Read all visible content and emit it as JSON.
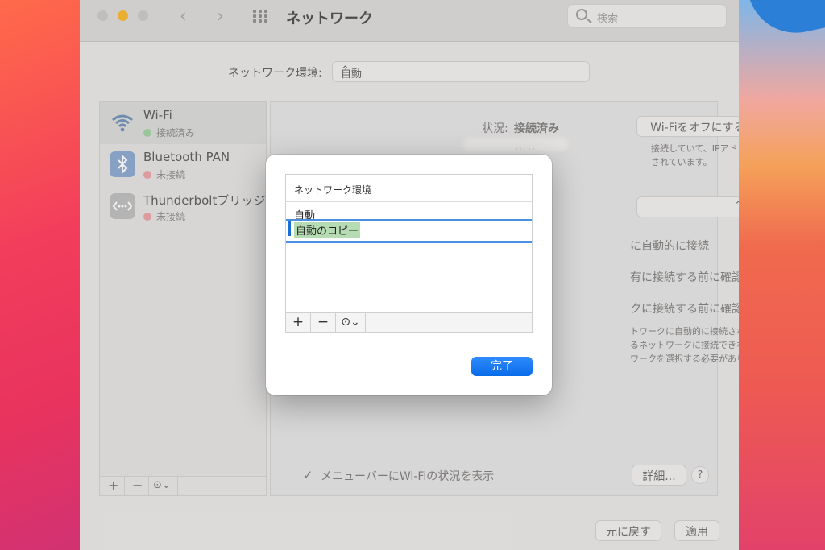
{
  "window": {
    "title": "ネットワーク",
    "search_placeholder": "検索",
    "nav_back": "‹",
    "nav_forward": "›"
  },
  "location": {
    "label": "ネットワーク環境:",
    "value": "自動"
  },
  "sidebar": {
    "services": [
      {
        "name": "Wi-Fi",
        "status": "接続済み",
        "status_color": "#5fbe60"
      },
      {
        "name": "Bluetooth PAN",
        "status": "未接続",
        "status_color": "#e5484d"
      },
      {
        "name": "Thunderboltブリッジ",
        "status": "未接続",
        "status_color": "#e5484d"
      }
    ],
    "add": "+",
    "remove": "−",
    "more": "⊙⌄"
  },
  "detail": {
    "status_label": "状況:",
    "status_value": "接続済み",
    "wifi_off_button": "Wi-Fiをオフにする",
    "desc_line1": "Wi-Fi",
    "desc_line1b": "接続していて、IPアド",
    "desc_line2": "されています。",
    "opt1": "に自動的に接続",
    "opt2": "有に接続する前に確認",
    "opt3": "クに接続する前に確認",
    "note1": "トワークに自動的に接続され",
    "note2": "るネットワークに接続できな",
    "note3": "ワークを選択する必要があり",
    "menubar_check": "メニューバーにWi-Fiの状況を表示",
    "advanced_button": "詳細...",
    "help_button": "?",
    "revert_button": "元に戻す",
    "apply_button": "適用"
  },
  "sheet": {
    "column_header": "ネットワーク環境",
    "rows": [
      "自動",
      "自動のコピー"
    ],
    "add": "+",
    "remove": "−",
    "more": "⊙⌄",
    "done_button": "完了"
  },
  "colors": {
    "accent": "#0a6be8",
    "traffic_min": "#f6b62a",
    "edit_highlight": "#b6dcb3"
  }
}
